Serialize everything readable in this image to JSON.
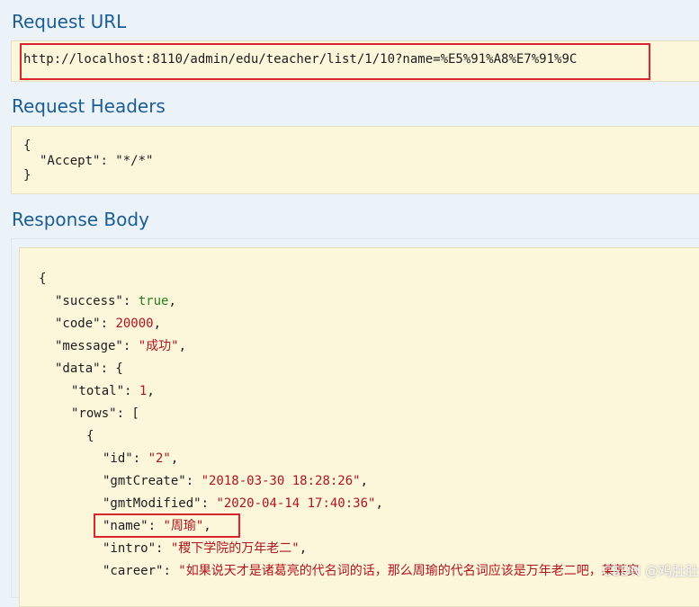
{
  "sections": {
    "request_url_title": "Request URL",
    "request_headers_title": "Request Headers",
    "response_body_title": "Response Body"
  },
  "request_url": "http://localhost:8110/admin/edu/teacher/list/1/10?name=%E5%91%A8%E7%91%9C",
  "request_headers": {
    "open": "{",
    "accept_key": "\"Accept\"",
    "accept_sep": ": ",
    "accept_value": "\"*/*\"",
    "close": "}"
  },
  "response_body": {
    "open": "{",
    "success_key": "\"success\"",
    "success_value": "true",
    "code_key": "\"code\"",
    "code_value": "20000",
    "message_key": "\"message\"",
    "message_value": "\"成功\"",
    "data_key": "\"data\"",
    "total_key": "\"total\"",
    "total_value": "1",
    "rows_key": "\"rows\"",
    "row_open": "{",
    "id_key": "\"id\"",
    "id_value": "\"2\"",
    "gmtCreate_key": "\"gmtCreate\"",
    "gmtCreate_value": "\"2018-03-30 18:28:26\"",
    "gmtModified_key": "\"gmtModified\"",
    "gmtModified_value": "\"2020-04-14 17:40:36\"",
    "name_key": "\"name\"",
    "name_value": "\"周瑜\"",
    "intro_key": "\"intro\"",
    "intro_value": "\"稷下学院的万年老二\"",
    "career_key": "\"career\"",
    "career_value": "\"如果说天才是诸葛亮的代名词的话，那么周瑜的代名词应该是万年老二吧，某某实"
  },
  "colors": {
    "title": "#1a5d94",
    "highlight": "#d9262c",
    "box_bg": "#fcf6db",
    "string": "#b0151d",
    "boolean": "#2d7d1e"
  },
  "watermark": "CSDN @鸡肚肚"
}
